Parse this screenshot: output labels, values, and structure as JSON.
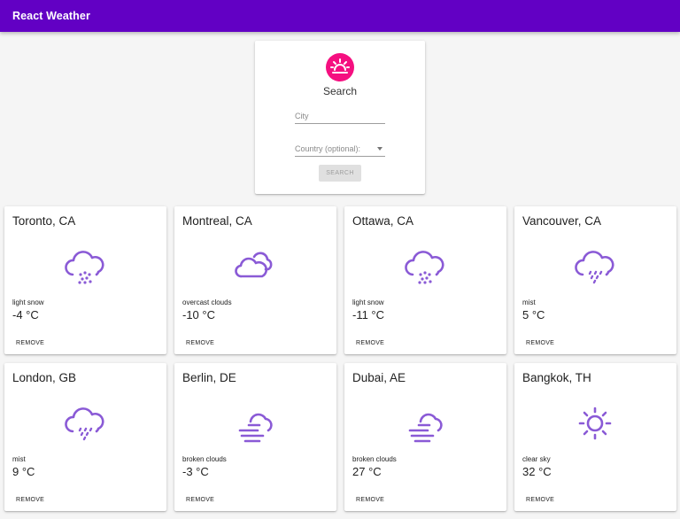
{
  "appbar": {
    "title": "React Weather",
    "color": "#6200c4"
  },
  "search": {
    "logo_icon": "weather-sunrise-icon",
    "logo_color": "#f50f80",
    "title": "Search",
    "city_placeholder": "City",
    "country_placeholder": "Country (optional):",
    "button_label": "SEARCH"
  },
  "cards": [
    {
      "city": "Toronto, CA",
      "icon": "snow-cloud-icon",
      "description": "light snow",
      "temp": "-4 °C",
      "remove_label": "REMOVE"
    },
    {
      "city": "Montreal, CA",
      "icon": "overcast-clouds-icon",
      "description": "overcast clouds",
      "temp": "-10 °C",
      "remove_label": "REMOVE"
    },
    {
      "city": "Ottawa, CA",
      "icon": "snow-cloud-icon",
      "description": "light snow",
      "temp": "-11 °C",
      "remove_label": "REMOVE"
    },
    {
      "city": "Vancouver, CA",
      "icon": "mist-cloud-icon",
      "description": "mist",
      "temp": "5 °C",
      "remove_label": "REMOVE"
    },
    {
      "city": "London, GB",
      "icon": "mist-cloud-icon",
      "description": "mist",
      "temp": "9 °C",
      "remove_label": "REMOVE"
    },
    {
      "city": "Berlin, DE",
      "icon": "broken-clouds-icon",
      "description": "broken clouds",
      "temp": "-3 °C",
      "remove_label": "REMOVE"
    },
    {
      "city": "Dubai, AE",
      "icon": "broken-clouds-icon",
      "description": "broken clouds",
      "temp": "27 °C",
      "remove_label": "REMOVE"
    },
    {
      "city": "Bangkok, TH",
      "icon": "clear-sky-icon",
      "description": "clear sky",
      "temp": "32 °C",
      "remove_label": "REMOVE"
    }
  ],
  "icon_color": "#8a5ad6"
}
